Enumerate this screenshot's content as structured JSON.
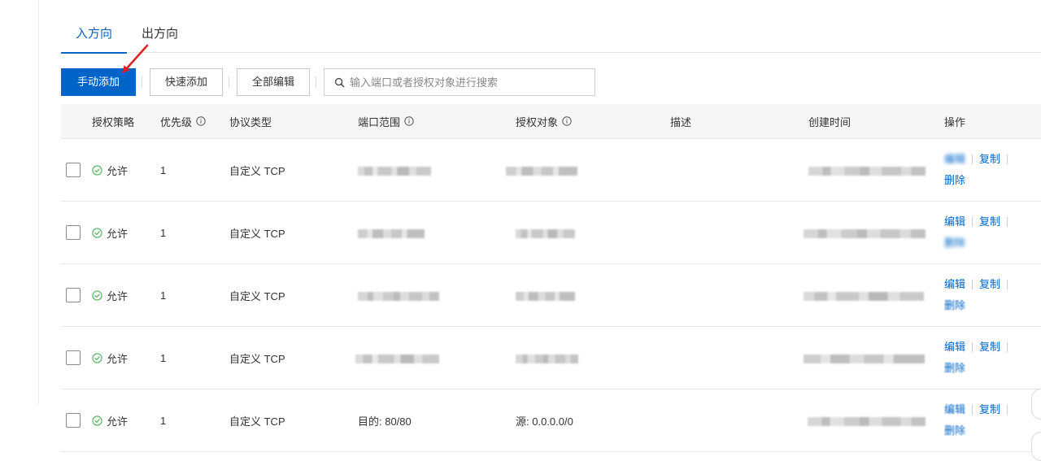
{
  "tabs": [
    {
      "label": "入方向",
      "active": true
    },
    {
      "label": "出方向",
      "active": false
    }
  ],
  "toolbar": {
    "manual_add": "手动添加",
    "quick_add": "快速添加",
    "edit_all": "全部编辑",
    "search_placeholder": "输入端口或者授权对象进行搜索"
  },
  "table": {
    "columns": [
      "授权策略",
      "优先级",
      "协议类型",
      "端口范围",
      "授权对象",
      "描述",
      "创建时间",
      "操作"
    ],
    "rows": [
      {
        "policy": "允许",
        "priority": "1",
        "protocol": "自定义 TCP"
      },
      {
        "policy": "允许",
        "priority": "1",
        "protocol": "自定义 TCP"
      },
      {
        "policy": "允许",
        "priority": "1",
        "protocol": "自定义 TCP"
      },
      {
        "policy": "允许",
        "priority": "1",
        "protocol": "自定义 TCP"
      },
      {
        "policy": "允许",
        "priority": "1",
        "protocol": "自定义 TCP",
        "port_range": "目的: 80/80",
        "auth_object": "源: 0.0.0.0/0"
      }
    ],
    "actions": {
      "edit": "编辑",
      "copy": "复制",
      "delete": "删除"
    }
  },
  "icons": {
    "search": "search-icon",
    "allow": "check-circle-icon",
    "info": "info-icon",
    "annotation": "red-arrow-icon"
  },
  "colors": {
    "primary": "#0064c8",
    "allow": "#52b35c",
    "annotation": "#e02020"
  }
}
